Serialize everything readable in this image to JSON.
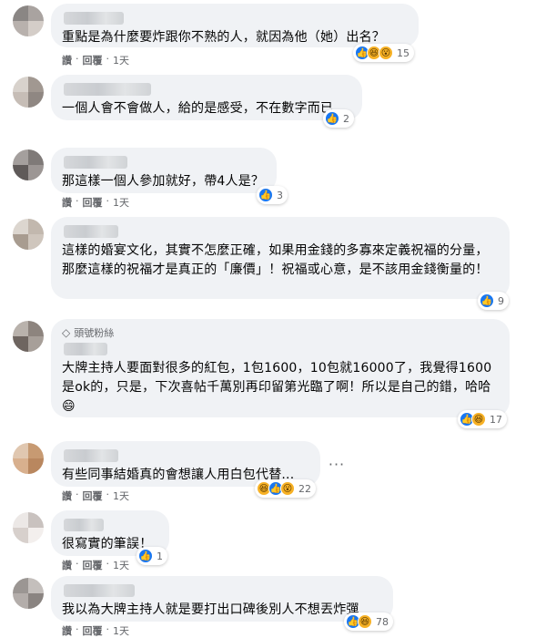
{
  "comments": [
    {
      "text": "重點是為什麼要炸跟你不熟的人，就因為他（她）出名？",
      "reactions": [
        "like",
        "haha",
        "wow"
      ],
      "count": "15",
      "actions": [
        "讚",
        "·",
        "回覆",
        "·",
        "1天"
      ]
    },
    {
      "text": "一個人會不會做人，給的是感受，不在數字而已",
      "reactions": [
        "like"
      ],
      "count": "2"
    },
    {
      "text": "那這樣一個人參加就好，帶4人是？",
      "reactions": [
        "like"
      ],
      "count": "3",
      "actions": [
        "讚",
        "·",
        "回覆",
        "·",
        "1天"
      ]
    },
    {
      "text": "這樣的婚宴文化，其實不怎麼正確，如果用金錢的多寡來定義祝福的分量，那麼這樣的祝福才是真正的「廉價」！祝福或心意，是不該用金錢衡量的！",
      "reactions": [
        "like"
      ],
      "count": "9"
    },
    {
      "badge": "頭號粉絲",
      "text": "大牌主持人要面對很多的紅包，1包1600，10包就16000了，我覺得1600是ok的，只是，下次喜帖千萬別再印留第光臨了啊！所以是自己的錯，哈哈😄",
      "reactions": [
        "like",
        "haha"
      ],
      "count": "17"
    },
    {
      "text": "有些同事結婚真的會想讓人用白包代替...",
      "reactions": [
        "haha",
        "like",
        "wow"
      ],
      "count": "22",
      "actions": [
        "讚",
        "·",
        "回覆",
        "·",
        "1天"
      ]
    },
    {
      "text": "很寫實的筆誤！",
      "reactions": [
        "like"
      ],
      "count": "1",
      "actions": [
        "讚",
        "·",
        "回覆",
        "·",
        "1天"
      ]
    },
    {
      "text": "我以為大牌主持人就是要打出口碑後別人不想丟炸彈",
      "reactions": [
        "like",
        "haha"
      ],
      "count": "78",
      "actions": [
        "讚",
        "·",
        "回覆",
        "·",
        "1天"
      ]
    }
  ],
  "more_icon": "ellipsis-icon",
  "fan_icon": "diamond-icon",
  "colors": {
    "bubble": "#f0f2f5",
    "like": "#1877f2",
    "haha": "#f7b125",
    "meta": "#65676b"
  }
}
